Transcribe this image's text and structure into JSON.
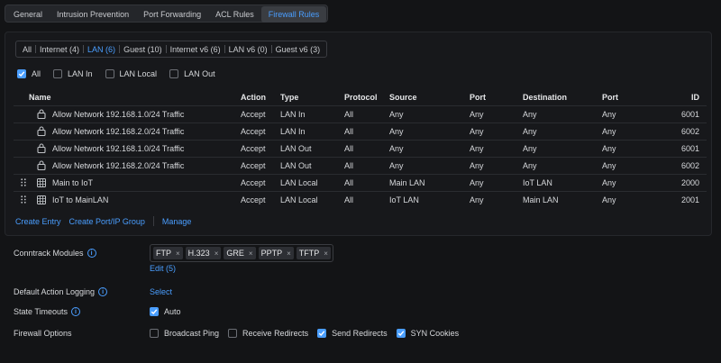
{
  "tabs": [
    {
      "label": "General",
      "active": false
    },
    {
      "label": "Intrusion Prevention",
      "active": false
    },
    {
      "label": "Port Forwarding",
      "active": false
    },
    {
      "label": "ACL Rules",
      "active": false
    },
    {
      "label": "Firewall Rules",
      "active": true
    }
  ],
  "filters": [
    {
      "label": "All",
      "active": false
    },
    {
      "label": "Internet (4)",
      "active": false
    },
    {
      "label": "LAN (6)",
      "active": true
    },
    {
      "label": "Guest (10)",
      "active": false
    },
    {
      "label": "Internet v6 (6)",
      "active": false
    },
    {
      "label": "LAN v6 (0)",
      "active": false
    },
    {
      "label": "Guest v6 (3)",
      "active": false
    }
  ],
  "type_checks": [
    {
      "label": "All",
      "checked": true
    },
    {
      "label": "LAN In",
      "checked": false
    },
    {
      "label": "LAN Local",
      "checked": false
    },
    {
      "label": "LAN Out",
      "checked": false
    }
  ],
  "table": {
    "headers": [
      "Name",
      "Action",
      "Type",
      "Protocol",
      "Source",
      "Port",
      "Destination",
      "Port",
      "ID"
    ],
    "rows": [
      {
        "icon": "lock-icon",
        "draggable": false,
        "name": "Allow Network 192.168.1.0/24 Traffic",
        "action": "Accept",
        "type": "LAN In",
        "protocol": "All",
        "source": "Any",
        "sport": "Any",
        "destination": "Any",
        "dport": "Any",
        "id": "6001"
      },
      {
        "icon": "lock-icon",
        "draggable": false,
        "name": "Allow Network 192.168.2.0/24 Traffic",
        "action": "Accept",
        "type": "LAN In",
        "protocol": "All",
        "source": "Any",
        "sport": "Any",
        "destination": "Any",
        "dport": "Any",
        "id": "6002"
      },
      {
        "icon": "lock-icon",
        "draggable": false,
        "name": "Allow Network 192.168.1.0/24 Traffic",
        "action": "Accept",
        "type": "LAN Out",
        "protocol": "All",
        "source": "Any",
        "sport": "Any",
        "destination": "Any",
        "dport": "Any",
        "id": "6001"
      },
      {
        "icon": "lock-icon",
        "draggable": false,
        "name": "Allow Network 192.168.2.0/24 Traffic",
        "action": "Accept",
        "type": "LAN Out",
        "protocol": "All",
        "source": "Any",
        "sport": "Any",
        "destination": "Any",
        "dport": "Any",
        "id": "6002"
      },
      {
        "icon": "rule-grid-icon",
        "draggable": true,
        "name": "Main to IoT",
        "action": "Accept",
        "type": "LAN Local",
        "protocol": "All",
        "source": "Main LAN",
        "sport": "Any",
        "destination": "IoT LAN",
        "dport": "Any",
        "id": "2000"
      },
      {
        "icon": "rule-grid-icon",
        "draggable": true,
        "name": "IoT to MainLAN",
        "action": "Accept",
        "type": "LAN Local",
        "protocol": "All",
        "source": "IoT LAN",
        "sport": "Any",
        "destination": "Main LAN",
        "dport": "Any",
        "id": "2001"
      }
    ]
  },
  "actions": {
    "create_entry": "Create Entry",
    "create_group": "Create Port/IP Group",
    "manage": "Manage"
  },
  "settings": {
    "conntrack": {
      "label": "Conntrack Modules",
      "tags": [
        "FTP",
        "H.323",
        "GRE",
        "PPTP",
        "TFTP"
      ],
      "edit": "Edit (5)"
    },
    "default_logging": {
      "label": "Default Action Logging",
      "value": "Select"
    },
    "state_timeouts": {
      "label": "State Timeouts",
      "option": "Auto",
      "checked": true
    },
    "firewall_options": {
      "label": "Firewall Options",
      "options": [
        {
          "label": "Broadcast Ping",
          "checked": false
        },
        {
          "label": "Receive Redirects",
          "checked": false
        },
        {
          "label": "Send Redirects",
          "checked": true
        },
        {
          "label": "SYN Cookies",
          "checked": true
        }
      ]
    }
  },
  "colors": {
    "accent": "#4a9eff",
    "background": "#131416",
    "panel": "#17181b"
  }
}
